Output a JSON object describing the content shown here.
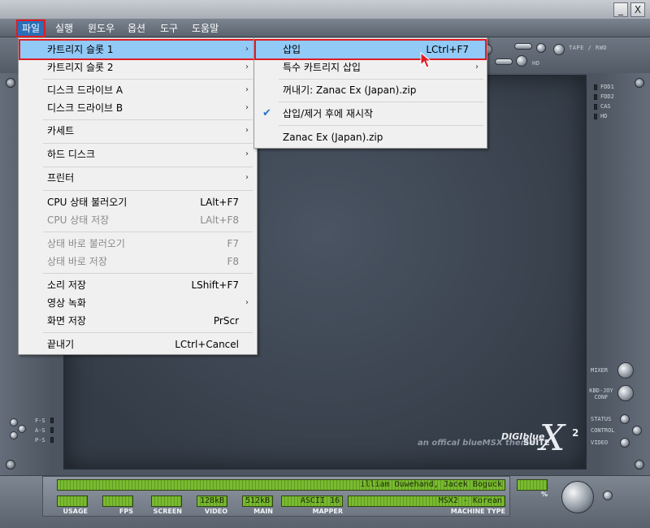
{
  "menubar": {
    "items": [
      "파일",
      "실행",
      "윈도우",
      "옵션",
      "도구",
      "도움말"
    ]
  },
  "window_buttons": {
    "minimize": "_",
    "close": "X"
  },
  "top_panel": {
    "tape_label": "TAPE / RWD",
    "hd_label": "HD"
  },
  "right_leds": [
    "FDD1",
    "FDD2",
    "CAS",
    "HD"
  ],
  "left_leds": [
    "F-S",
    "A-S",
    "P-S"
  ],
  "right_controls": [
    "MIXER",
    "KBD-JOY CONF",
    "STATUS",
    "CONTROL",
    "VIDEO"
  ],
  "brand": {
    "name": "DIGIblue",
    "suite": "SUITE",
    "tagline": "an offical blueMSX theme",
    "x": "X",
    "two": "2"
  },
  "file_menu": {
    "items": [
      {
        "label": "카트리지 슬롯 1",
        "accel": "",
        "submenu": true,
        "disabled": false,
        "highlight": true
      },
      {
        "label": "카트리지 슬롯 2",
        "accel": "",
        "submenu": true,
        "disabled": false
      },
      {
        "label": "디스크 드라이브 A",
        "accel": "",
        "submenu": true,
        "disabled": false
      },
      {
        "label": "디스크 드라이브 B",
        "accel": "",
        "submenu": true,
        "disabled": false
      },
      {
        "label": "카세트",
        "accel": "",
        "submenu": true,
        "disabled": false
      },
      {
        "label": "하드 디스크",
        "accel": "",
        "submenu": true,
        "disabled": false
      },
      {
        "label": "프린터",
        "accel": "",
        "submenu": true,
        "disabled": false
      },
      {
        "label": "CPU 상태 불러오기",
        "accel": "LAlt+F7",
        "submenu": false,
        "disabled": false
      },
      {
        "label": "CPU 상태 저장",
        "accel": "LAlt+F8",
        "submenu": false,
        "disabled": true
      },
      {
        "label": "상태 바로 불러오기",
        "accel": "F7",
        "submenu": false,
        "disabled": true
      },
      {
        "label": "상태 바로 저장",
        "accel": "F8",
        "submenu": false,
        "disabled": true
      },
      {
        "label": "소리 저장",
        "accel": "LShift+F7",
        "submenu": false,
        "disabled": false
      },
      {
        "label": "영상 녹화",
        "accel": "",
        "submenu": true,
        "disabled": false
      },
      {
        "label": "화면 저장",
        "accel": "PrScr",
        "submenu": false,
        "disabled": false
      },
      {
        "label": "끝내기",
        "accel": "LCtrl+Cancel",
        "submenu": false,
        "disabled": false
      }
    ]
  },
  "cart_submenu": {
    "items": [
      {
        "label": "삽입",
        "accel": "LCtrl+F7",
        "submenu": false,
        "highlight": true,
        "checked": false
      },
      {
        "label": "특수 카트리지 삽입",
        "accel": "",
        "submenu": true,
        "checked": false
      },
      {
        "label": "꺼내기: Zanac Ex (Japan).zip",
        "accel": "",
        "submenu": false,
        "checked": false
      },
      {
        "label": "삽입/제거 후에 재시작",
        "accel": "",
        "submenu": false,
        "checked": true
      },
      {
        "label": "Zanac Ex (Japan).zip",
        "accel": "",
        "submenu": false,
        "checked": false
      }
    ]
  },
  "status": {
    "credits": "illiam Ouwehand, Jacek Boguck",
    "usage_label": "USAGE",
    "fps_label": "FPS",
    "screen_label": "SCREEN",
    "video_value": "128kB",
    "video_label": "VIDEO",
    "main_value": "512kB",
    "main_label": "MAIN",
    "mapper_value": "ASCII 16",
    "mapper_label": "MAPPER",
    "machine_value": "MSX2 - Korean",
    "machine_label": "MACHINE TYPE",
    "percent_label": "%"
  },
  "colors": {
    "highlight": "#91c9f7",
    "menu_active": "#2b6fb6",
    "annotation": "#e01b24",
    "lcd": "#6fae2a"
  }
}
